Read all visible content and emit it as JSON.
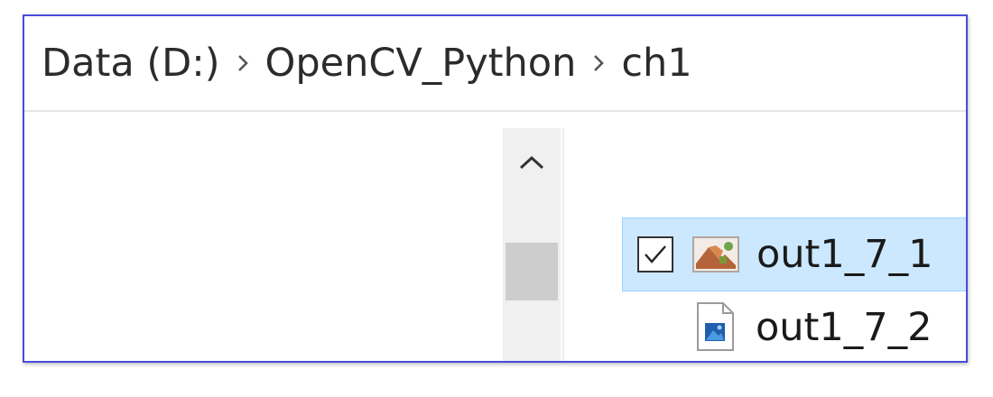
{
  "breadcrumb": {
    "items": [
      {
        "label": "Data (D:)"
      },
      {
        "label": "OpenCV_Python"
      },
      {
        "label": "ch1"
      }
    ],
    "separator_icon": "chevron-right-icon"
  },
  "navigation_pane": {
    "scroll_up_icon": "chevron-up-icon"
  },
  "files": [
    {
      "name": "out1_7_1",
      "selected": true,
      "checked": true,
      "icon": "image-thumbnail-icon"
    },
    {
      "name": "out1_7_2",
      "selected": false,
      "checked": false,
      "icon": "image-file-icon"
    }
  ],
  "colors": {
    "frame_border": "#4b4bdc",
    "selection_fill": "#cce8ff",
    "selection_border": "#99d1ff",
    "scrollbar_thumb": "#cdcdcd"
  }
}
